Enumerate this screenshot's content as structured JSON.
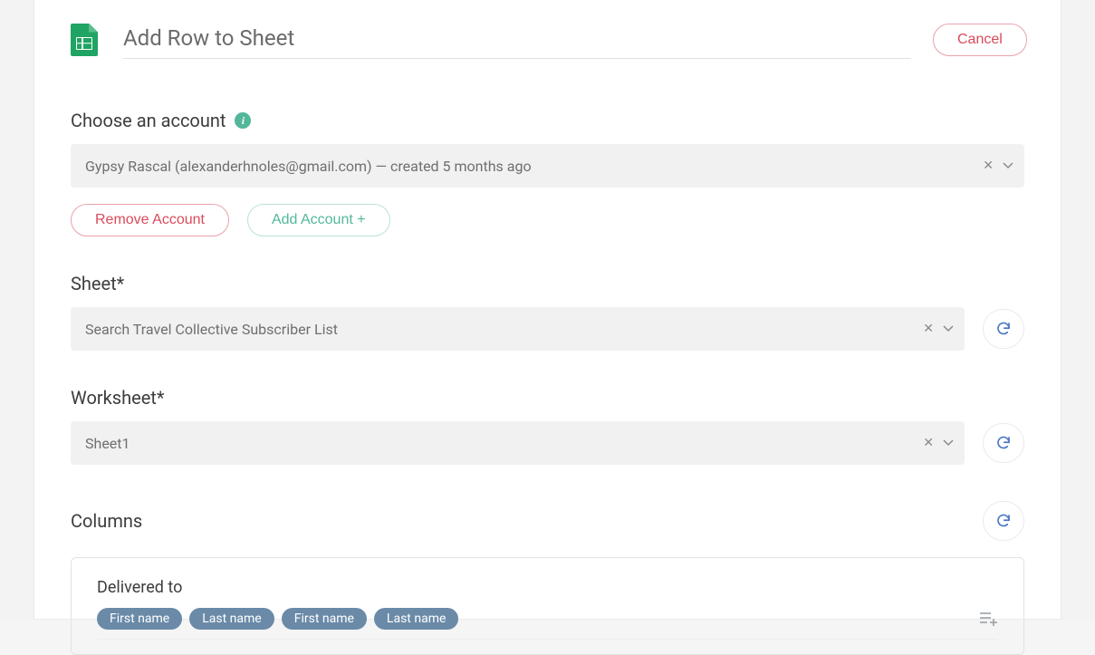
{
  "header": {
    "title": "Add Row to Sheet",
    "cancel_label": "Cancel"
  },
  "account": {
    "label": "Choose an account",
    "selected": "Gypsy Rascal (alexanderhnoles@gmail.com) — created 5 months ago",
    "remove_label": "Remove Account",
    "add_label": "Add Account +"
  },
  "sheet": {
    "label": "Sheet*",
    "value": "Search Travel Collective Subscriber List"
  },
  "worksheet": {
    "label": "Worksheet*",
    "value": "Sheet1"
  },
  "columns": {
    "label": "Columns",
    "groups": [
      {
        "title": "Delivered to",
        "pills": [
          "First name",
          "Last name",
          "First name",
          "Last name"
        ]
      }
    ]
  }
}
